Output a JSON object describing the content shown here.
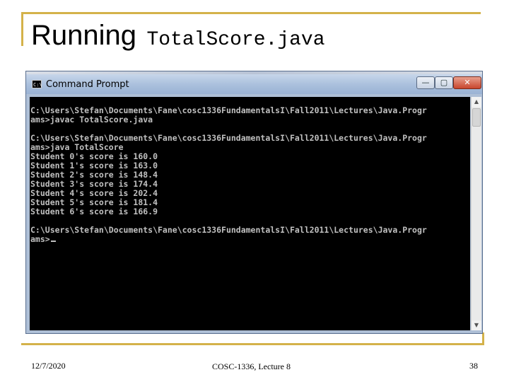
{
  "slide": {
    "title_main": "Running",
    "title_code": "TotalScore.java",
    "footer_date": "12/7/2020",
    "footer_course": "COSC-1336, Lecture 8",
    "footer_page": "38",
    "accent_color": "#d4b24a"
  },
  "window": {
    "title": "Command Prompt",
    "icon": "console-icon",
    "minimize_glyph": "—",
    "maximize_glyph": "▢",
    "close_glyph": "✕",
    "console_lines": [
      "C:\\Users\\Stefan\\Documents\\Fane\\cosc1336FundamentalsI\\Fall2011\\Lectures\\Java.Progr",
      "ams>javac TotalScore.java",
      "",
      "C:\\Users\\Stefan\\Documents\\Fane\\cosc1336FundamentalsI\\Fall2011\\Lectures\\Java.Progr",
      "ams>java TotalScore",
      "Student 0's score is 160.0",
      "Student 1's score is 163.0",
      "Student 2's score is 148.4",
      "Student 3's score is 174.4",
      "Student 4's score is 202.4",
      "Student 5's score is 181.4",
      "Student 6's score is 166.9",
      "",
      "C:\\Users\\Stefan\\Documents\\Fane\\cosc1336FundamentalsI\\Fall2011\\Lectures\\Java.Progr",
      "ams>"
    ],
    "console_bg": "#000000",
    "console_fg": "#c0c0c0"
  }
}
